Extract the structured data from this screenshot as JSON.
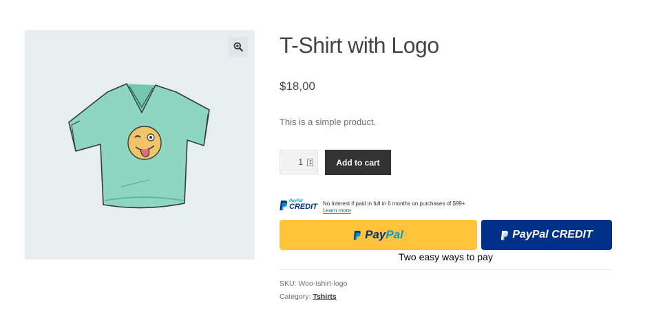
{
  "product": {
    "title": "T-Shirt with Logo",
    "price": "$18,00",
    "description": "This is a simple product.",
    "quantity": "1",
    "add_to_cart_label": "Add to cart",
    "image_icon": "tshirt-emoji-image",
    "zoom_icon": "zoom-in-icon"
  },
  "paypal": {
    "credit_logo_small": "PayPal",
    "credit_logo_big": "CREDIT",
    "credit_message": "No Interest if paid in full in 6 months on purchases of $99+",
    "learn_more": "Learn more",
    "paypal_button": {
      "word1": "Pay",
      "word2": "Pal"
    },
    "credit_button": {
      "label": "PayPal CREDIT"
    },
    "tagline": "Two easy ways to pay"
  },
  "meta": {
    "sku_label": "SKU:",
    "sku_value": "Woo-tshirt-logo",
    "category_label": "Category:",
    "category_value": "Tshirts"
  },
  "colors": {
    "paypal_gold": "#ffc439",
    "paypal_blue": "#003087",
    "paypal_light_blue": "#009cde",
    "button_dark": "#333333",
    "gallery_bg": "#e8eef0"
  }
}
